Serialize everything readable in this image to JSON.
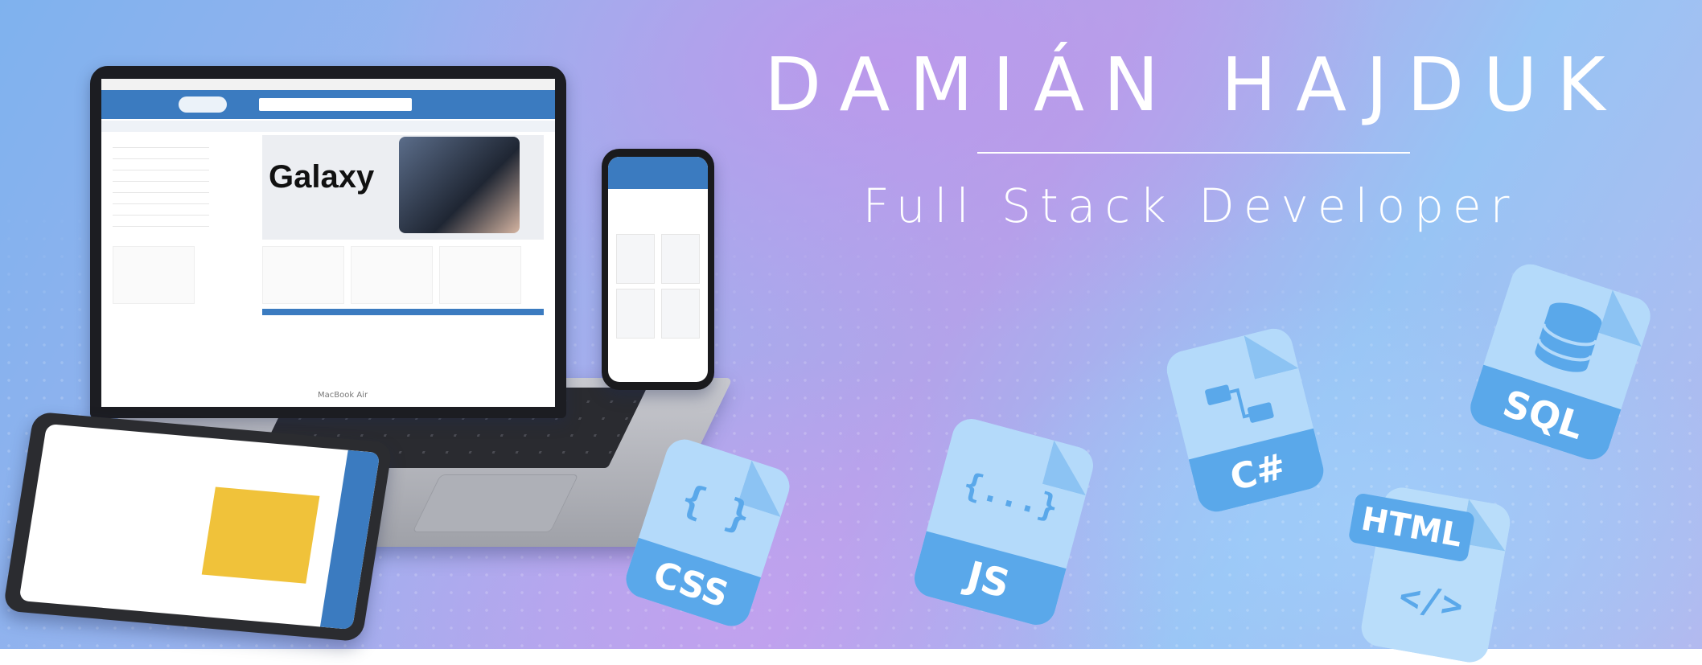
{
  "name": "DAMIÁN HAJDUK",
  "role": "Full Stack Developer",
  "devices": {
    "laptop_label": "MacBook Air",
    "screen_galaxy": "Galaxy"
  },
  "tech_icons": [
    {
      "label": "CSS",
      "glyph": "{ }"
    },
    {
      "label": "JS",
      "glyph": "{...}"
    },
    {
      "label": "C#",
      "glyph": ""
    },
    {
      "label": "SQL",
      "glyph": ""
    },
    {
      "label": "HTML",
      "glyph": "</>"
    }
  ],
  "colors": {
    "accent_blue": "#3b7bc0",
    "file_light": "#aed5f6",
    "file_band": "#5aa8ea"
  }
}
